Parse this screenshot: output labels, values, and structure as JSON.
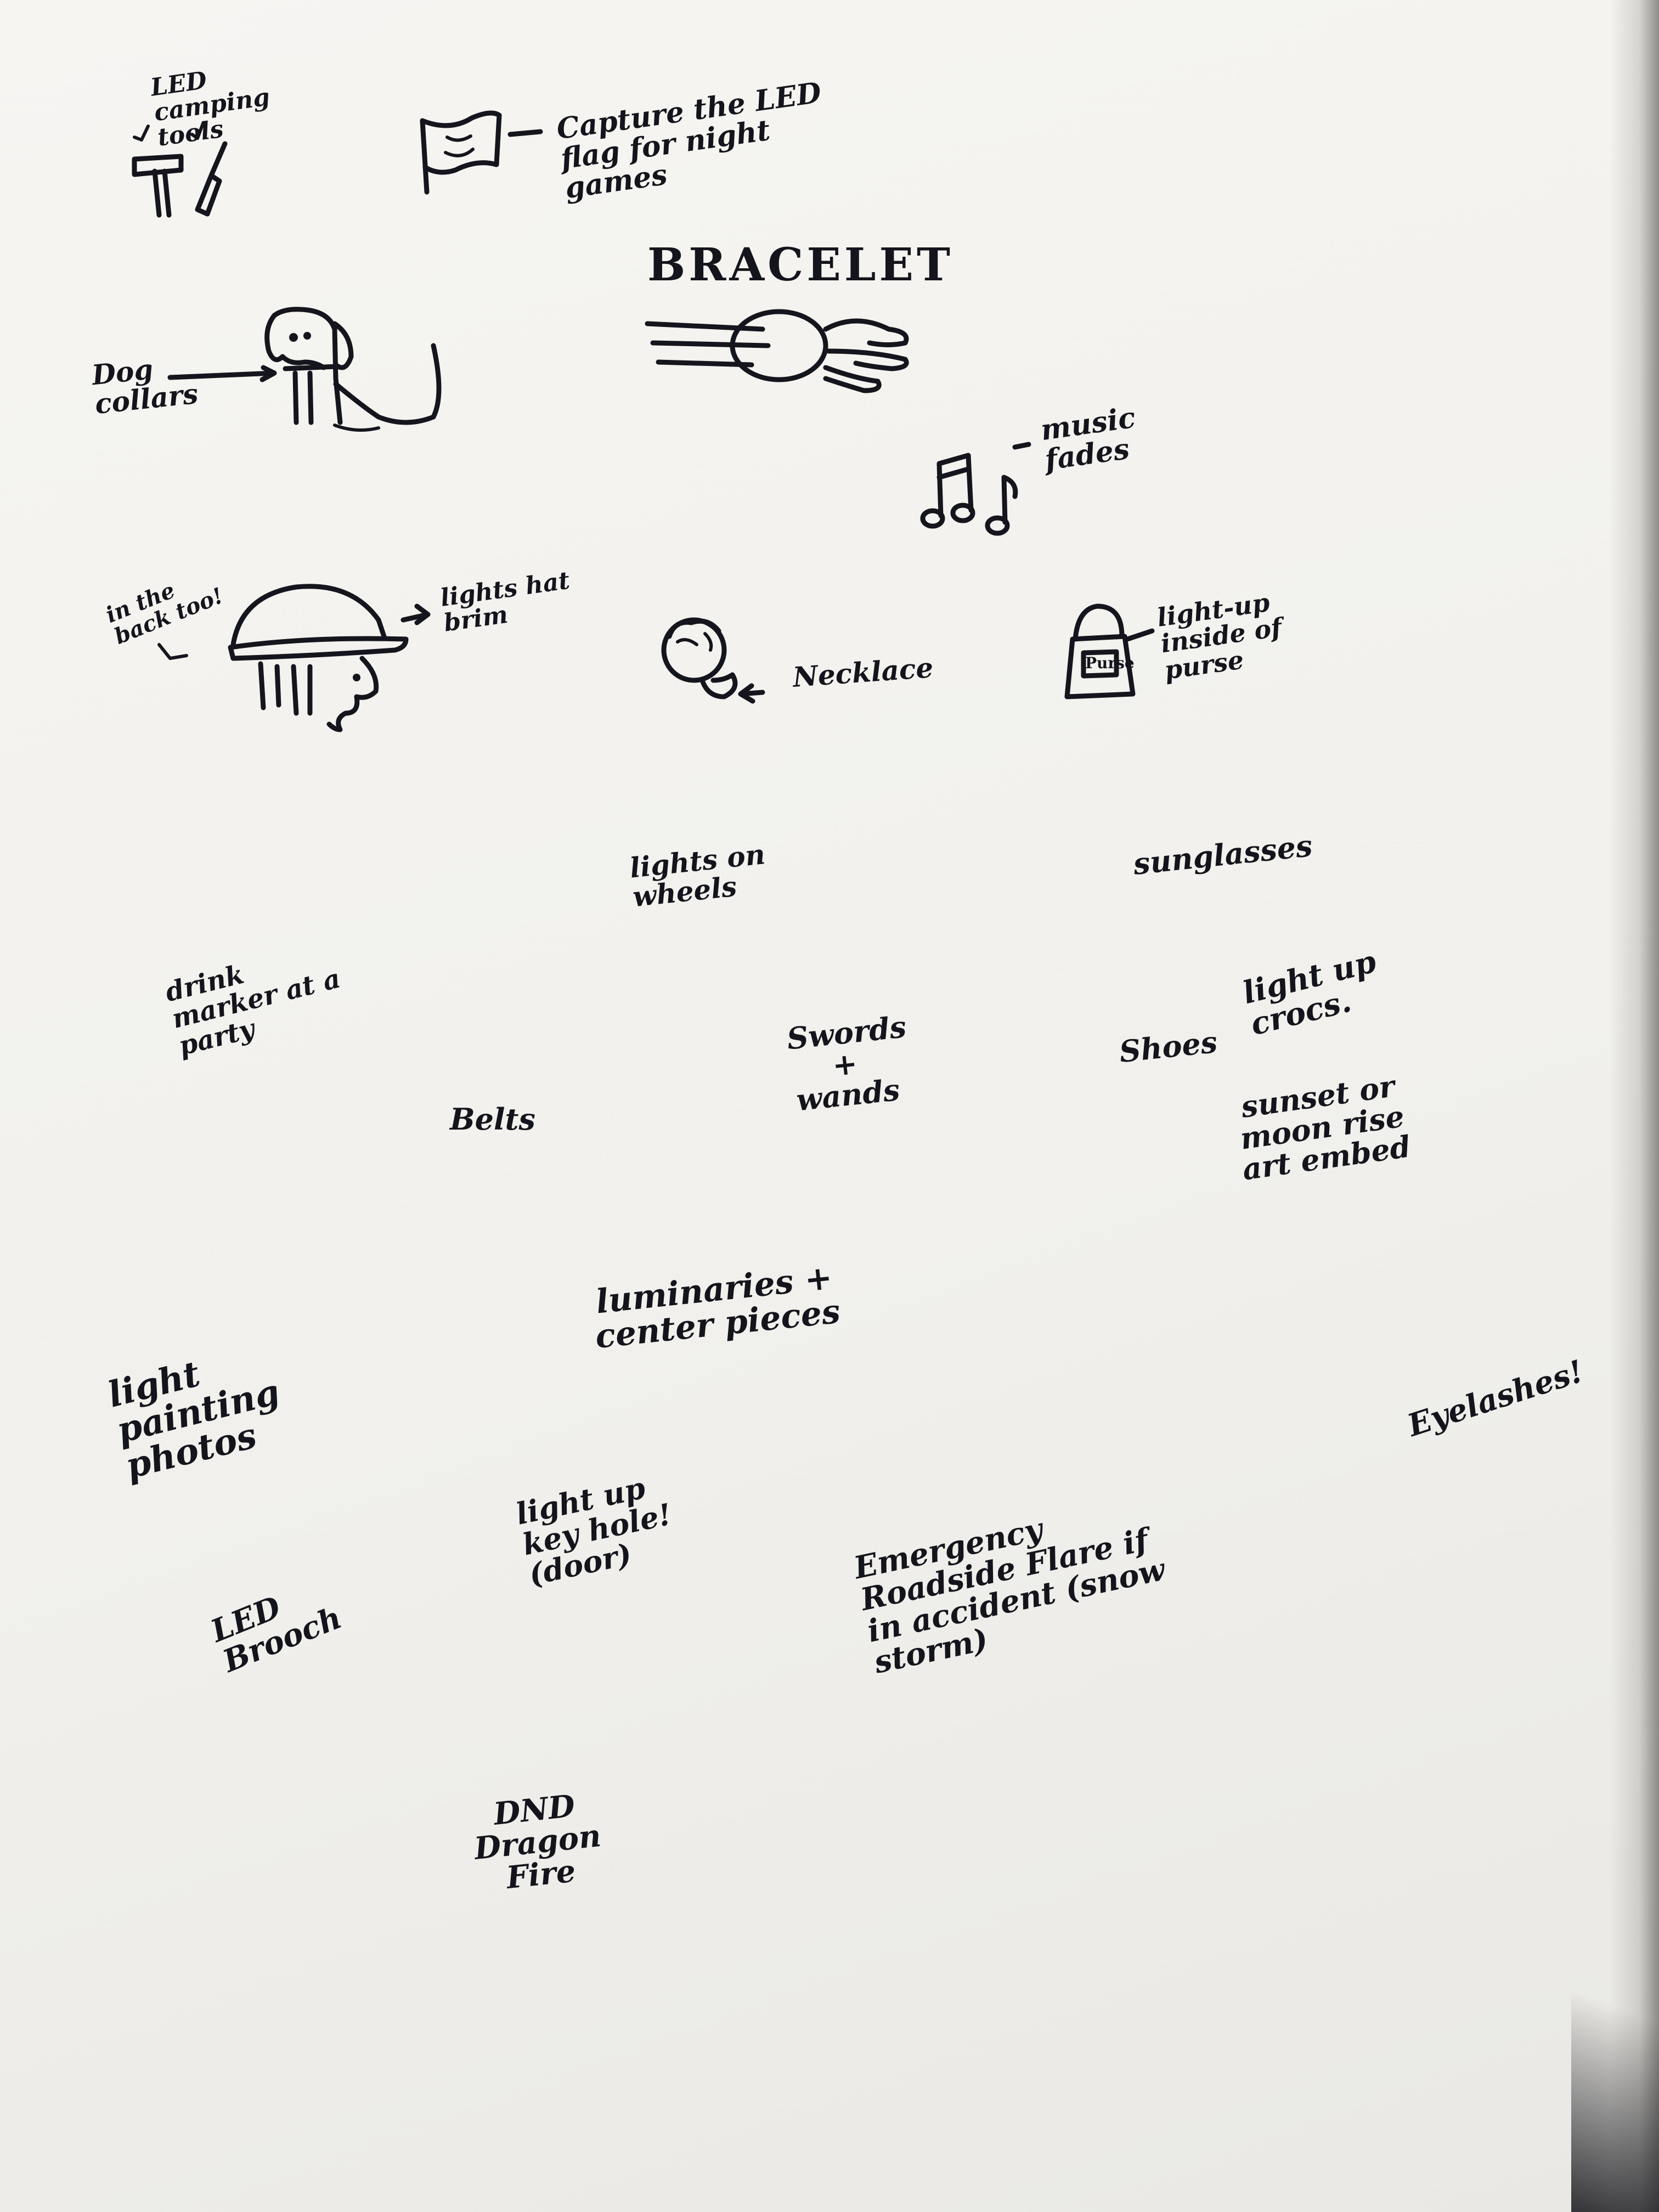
{
  "ideas": {
    "camping": {
      "label": "LED camping tools"
    },
    "flag": {
      "label": "Capture the LED flag for night games"
    },
    "bracelet": {
      "label": "BRACELET"
    },
    "dog": {
      "label": "Dog collars"
    },
    "music": {
      "label": "music fades"
    },
    "hat": {
      "note": "in the back too!",
      "label": "lights hat brim"
    },
    "necklace": {
      "label": "Necklace"
    },
    "purse": {
      "tag": "Purse",
      "label": "light-up inside of purse"
    },
    "bike": {
      "label": "lights on wheels"
    },
    "sunglasses": {
      "label": "sunglasses"
    },
    "drink": {
      "label": "drink marker at a party"
    },
    "sword": {
      "label": "Swords + wands"
    },
    "shoes": {
      "label": "Shoes",
      "extra": "light up crocs."
    },
    "belt": {
      "label": "Belts"
    },
    "sunset": {
      "label": "sunset or moon rise art embed"
    },
    "luminaries": {
      "label": "luminaries + center pieces"
    },
    "light_painting": {
      "label": "light painting photos"
    },
    "eyelashes": {
      "label": "Eyelashes!"
    },
    "keyhole": {
      "label": "light up key hole! (door)"
    },
    "emergency": {
      "label": "Emergency Roadside Flare if in accident (snow storm)"
    },
    "brooch": {
      "label": "LED Brooch"
    },
    "dragon": {
      "label": "DND Dragon Fire"
    }
  },
  "colors": {
    "ink": "#15151d",
    "paper": "#f4f3ef"
  }
}
